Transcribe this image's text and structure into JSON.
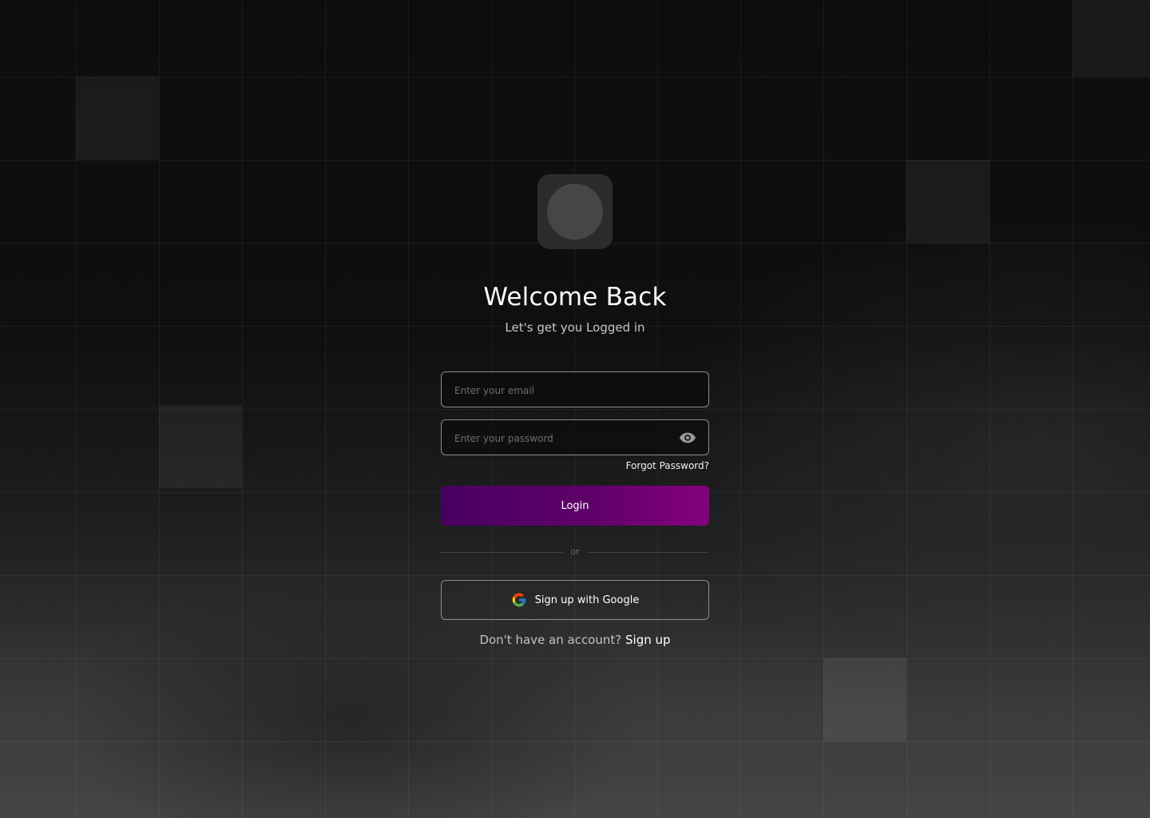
{
  "header": {
    "title": "Welcome Back",
    "subtitle": "Let's get you Logged in"
  },
  "form": {
    "email_placeholder": "Enter your email",
    "email_value": "",
    "password_placeholder": "Enter your password",
    "password_value": "",
    "forgot_password": "Forgot Password?",
    "login_label": "Login",
    "divider_text": "or",
    "google_label": "Sign up with Google"
  },
  "footer": {
    "prompt": "Don't have an account?",
    "signup_link": "Sign up"
  },
  "icons": {
    "logo": "logo-placeholder",
    "password_toggle": "eye-icon",
    "google": "google-icon"
  },
  "colors": {
    "accent_start": "#470060",
    "accent_end": "#83007d",
    "background": "#0d0d0d"
  }
}
